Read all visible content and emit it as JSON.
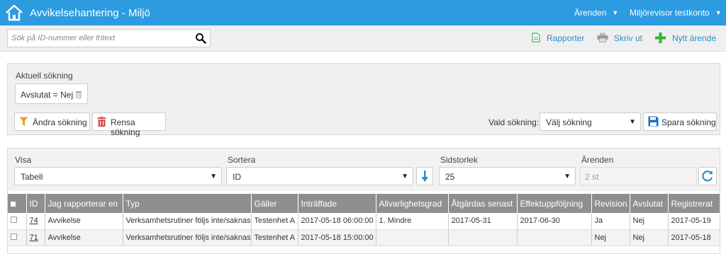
{
  "header": {
    "title": "Avvikelsehantering - Miljö",
    "menu_arenden": "Ärenden",
    "menu_user": "Miljörevisor testkonto"
  },
  "toolbar": {
    "search_placeholder": "Sök på ID-nummer eller fritext",
    "reports": "Rapporter",
    "print": "Skriv ut",
    "new_case": "Nytt ärende"
  },
  "search_panel": {
    "title": "Aktuell sökning",
    "filter_chip": "Avslutat = Nej",
    "change_button": "Ändra sökning",
    "clear_button": "Rensa sökning",
    "saved_label": "Vald sökning:",
    "saved_select": "Välj sökning",
    "save_button": "Spara sökning"
  },
  "results": {
    "view_label": "Visa",
    "view_value": "Tabell",
    "sort_label": "Sortera",
    "sort_value": "ID",
    "page_size_label": "Sidstorlek",
    "page_size_value": "25",
    "count_label": "Ärenden",
    "count_value": "2 st",
    "columns": [
      "ID",
      "Jag rapporterar en",
      "Typ",
      "Gäller",
      "Inträffade",
      "Allvarlighetsgrad",
      "Åtgärdas senast",
      "Effektuppföljning",
      "Revision",
      "Avslutat",
      "Registrerat"
    ],
    "rows": [
      [
        "74",
        "Avvikelse",
        "Verksamhetsrutiner följs inte/saknas",
        "Testenhet A",
        "2017-05-18 06:00:00",
        "1. Mindre",
        "2017-05-31",
        "2017-06-30",
        "Ja",
        "Nej",
        "2017-05-19"
      ],
      [
        "71",
        "Avvikelse",
        "Verksamhetsrutiner följs inte/saknas",
        "Testenhet A",
        "2017-05-18 15:00:00",
        "",
        "",
        "",
        "Nej",
        "Nej",
        "2017-05-18"
      ]
    ]
  },
  "colors": {
    "header_bg": "#2c9be0",
    "table_header_bg": "#8f8f8f",
    "link_blue": "#2c8fd0",
    "add_green": "#2eb82e",
    "filter_orange": "#f0a020",
    "trash_red": "#d9534f",
    "save_blue": "#1a6fc4"
  },
  "icons": [
    "home-icon",
    "search-icon",
    "report-doc-icon",
    "printer-icon",
    "plus-icon",
    "trash-icon",
    "funnel-icon",
    "floppy-disk-icon",
    "sort-down-arrow-icon",
    "refresh-icon",
    "chevron-down-icon"
  ]
}
